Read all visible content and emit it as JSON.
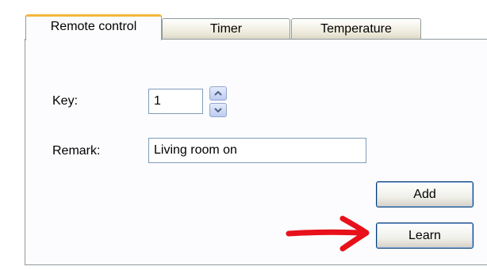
{
  "tabs": [
    {
      "label": "Remote control",
      "active": true
    },
    {
      "label": "Timer",
      "active": false
    },
    {
      "label": "Temperature",
      "active": false
    }
  ],
  "form": {
    "key_label": "Key:",
    "key_value": "1",
    "remark_label": "Remark:",
    "remark_value": "Living room on"
  },
  "buttons": {
    "add_label": "Add",
    "learn_label": "Learn"
  },
  "annotation": {
    "arrow_color": "#e8101a"
  },
  "colors": {
    "active_tab_accent": "#f5b73e",
    "button_border": "#003c74",
    "input_border": "#7f9db9"
  }
}
